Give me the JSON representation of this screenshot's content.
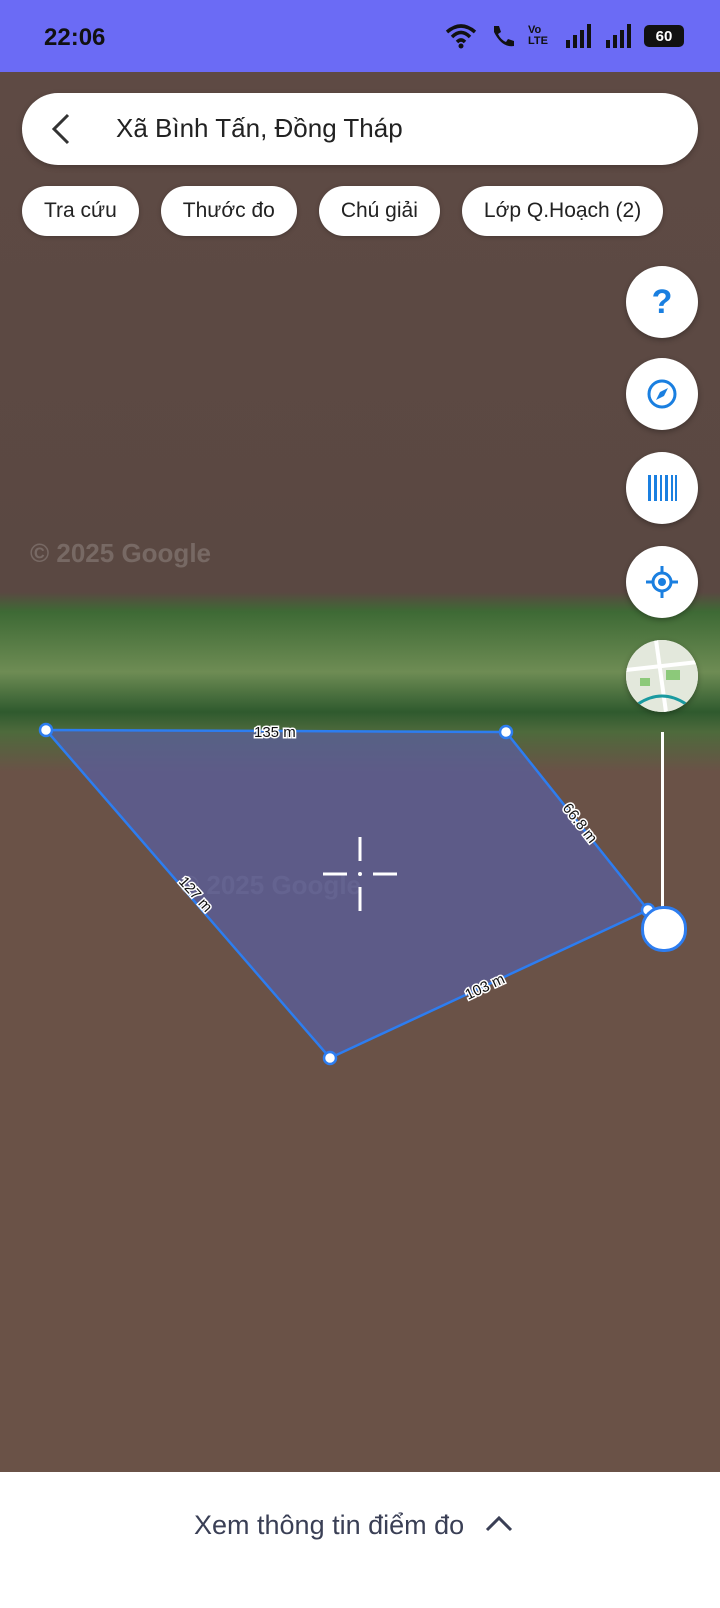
{
  "status_bar": {
    "time": "22:06",
    "battery": "60",
    "network": "Vo LTE"
  },
  "search": {
    "title": "Xã Bình Tấn, Đồng Tháp"
  },
  "chips": [
    {
      "label": "Tra cứu"
    },
    {
      "label": "Thước đo"
    },
    {
      "label": "Chú giải"
    },
    {
      "label": "Lớp Q.Hoạch (2)"
    }
  ],
  "fabs": [
    {
      "icon": "help-icon",
      "label": "?"
    },
    {
      "icon": "compass-icon"
    },
    {
      "icon": "barcode-icon"
    },
    {
      "icon": "my-location-icon"
    },
    {
      "icon": "map-thumbnail"
    }
  ],
  "map": {
    "watermark": "© 2025 Google"
  },
  "measurement": {
    "edges": [
      {
        "label": "135 m"
      },
      {
        "label": "66.8 m"
      },
      {
        "label": "103 m"
      },
      {
        "label": "127 m"
      }
    ]
  },
  "bottom_panel": {
    "label": "Xem thông tin điểm đo"
  },
  "colors": {
    "status_bar": "#6b6bf5",
    "accent": "#2d7df0",
    "polygon_fill": "#5a5f9e"
  }
}
